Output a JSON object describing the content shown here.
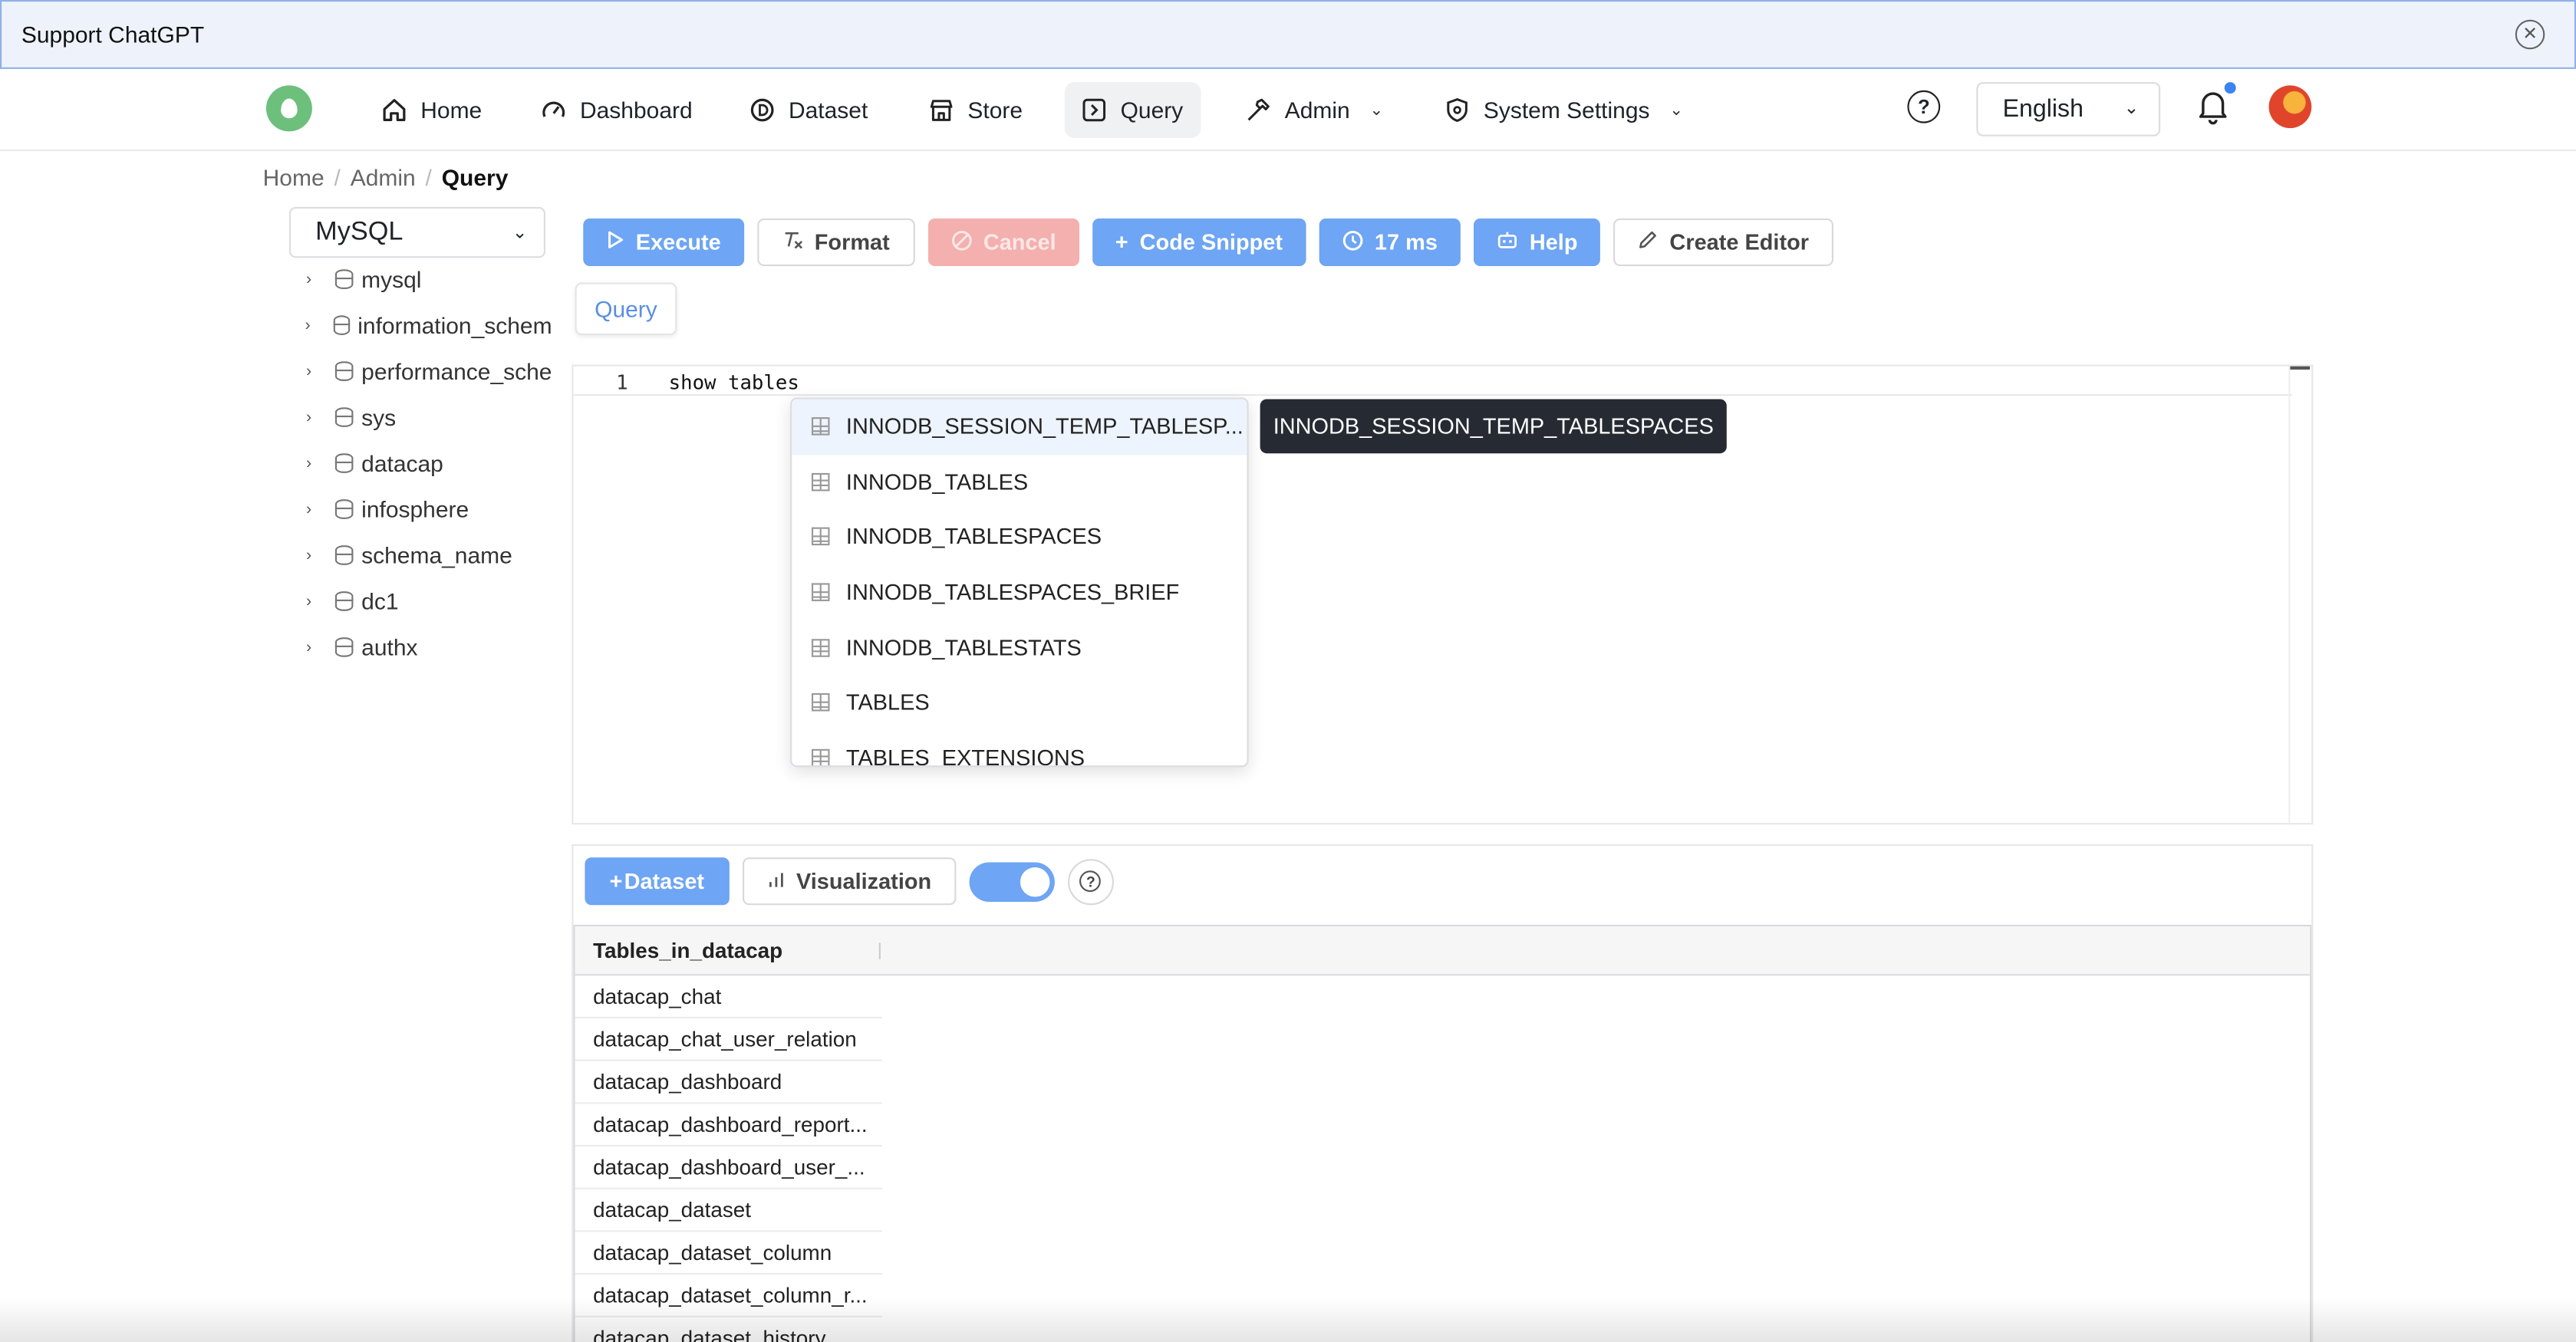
{
  "banner": {
    "title": "Support ChatGPT"
  },
  "nav": {
    "items": [
      {
        "label": "Home"
      },
      {
        "label": "Dashboard"
      },
      {
        "label": "Dataset"
      },
      {
        "label": "Store"
      },
      {
        "label": "Query"
      },
      {
        "label": "Admin"
      },
      {
        "label": "System Settings"
      }
    ],
    "help": "?",
    "language": "English"
  },
  "breadcrumb": {
    "items": [
      "Home",
      "Admin",
      "Query"
    ]
  },
  "sidebar": {
    "db_type": "MySQL",
    "databases": [
      "mysql",
      "information_schem",
      "performance_sche",
      "sys",
      "datacap",
      "infosphere",
      "schema_name",
      "dc1",
      "authx"
    ]
  },
  "toolbar": {
    "execute": "Execute",
    "format": "Format",
    "cancel": "Cancel",
    "snippet": "Code Snippet",
    "elapsed": "17 ms",
    "help": "Help",
    "create_editor": "Create Editor"
  },
  "editor": {
    "tab": "Query",
    "line_number": "1",
    "code": "show tables",
    "suggestions": [
      "INNODB_SESSION_TEMP_TABLESP...",
      "INNODB_TABLES",
      "INNODB_TABLESPACES",
      "INNODB_TABLESPACES_BRIEF",
      "INNODB_TABLESTATS",
      "TABLES",
      "TABLES_EXTENSIONS"
    ],
    "tooltip": "INNODB_SESSION_TEMP_TABLESPACES"
  },
  "results": {
    "dataset_btn": "Dataset",
    "visualization_btn": "Visualization",
    "help": "?",
    "column": "Tables_in_datacap",
    "rows": [
      "datacap_chat",
      "datacap_chat_user_relation",
      "datacap_dashboard",
      "datacap_dashboard_report...",
      "datacap_dashboard_user_...",
      "datacap_dataset",
      "datacap_dataset_column",
      "datacap_dataset_column_r...",
      "datacap_dataset_history"
    ]
  },
  "colors": {
    "primary": "#6ea5f4",
    "danger": "#f3b0ae",
    "tooltip_bg": "#262b33",
    "logo": "#6cc07c"
  }
}
